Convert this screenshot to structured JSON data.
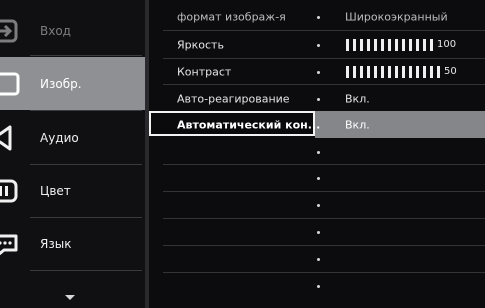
{
  "sidebar": {
    "items": [
      {
        "label": "Вход",
        "icon": "input-icon"
      },
      {
        "label": "Изобр.",
        "icon": "picture-icon"
      },
      {
        "label": "Аудио",
        "icon": "speaker-icon"
      },
      {
        "label": "Цвет",
        "icon": "color-icon"
      },
      {
        "label": "Язык",
        "icon": "language-icon"
      }
    ],
    "scroll_icon": "chevron-down-icon"
  },
  "menu": {
    "rows": [
      {
        "label": "формат изображ-я",
        "value": "Широкоэкранный"
      },
      {
        "label": "Яркость",
        "value": "100",
        "level_percent": 100
      },
      {
        "label": "Контраст",
        "value": "50",
        "level_percent": 50
      },
      {
        "label": "Авто-реагирование",
        "value": "Вкл."
      },
      {
        "label": "Автоматический кон...",
        "value": "Вкл."
      }
    ]
  },
  "colors": {
    "background": "#0c0c0e",
    "sidebar_active": "#8f9094",
    "value_highlight": "#85868a",
    "focus_border": "#f2f2f2",
    "text": "#e9e9ea"
  }
}
